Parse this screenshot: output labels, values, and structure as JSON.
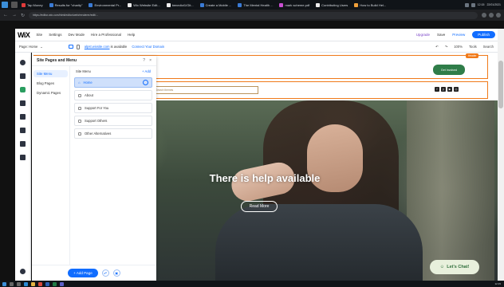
{
  "browser": {
    "tabs": [
      {
        "label": "Tap Money",
        "color": "#e03b3b"
      },
      {
        "label": "Results for \"charity\"",
        "color": "#3a7bd5"
      },
      {
        "label": "Environmental Pr...",
        "color": "#3a7bd5"
      },
      {
        "label": "Wix Website Edit...",
        "color": "#eeeeee"
      },
      {
        "label": "benedict1/Git...",
        "color": "#eeeeee"
      },
      {
        "label": "Create a Mobile ...",
        "color": "#3a7bd5"
      },
      {
        "label": "The Mental Health ...",
        "color": "#3a7bd5"
      },
      {
        "label": "mark scheme.pdf",
        "color": "#c94fd1"
      },
      {
        "label": "Contributing Users",
        "color": "#eeeeee"
      },
      {
        "label": "How to Build Hel...",
        "color": "#f0a03a"
      }
    ],
    "url": "https://editor.wix.com/html/editor/web/renderer/edit/...",
    "clock_time": "12:15",
    "clock_date": "22/01/2021"
  },
  "wix": {
    "logo": "WiX",
    "menu": [
      "Site",
      "Settings",
      "Dev Mode",
      "Hire a Professional",
      "Help"
    ],
    "right": {
      "upgrade": "Upgrade",
      "save": "Save",
      "preview": "Preview",
      "publish": "Publish"
    },
    "subbar": {
      "page_label": "Page: Home",
      "domain_link": "alpst.wixsite.com",
      "domain_status": "is available",
      "connect": "Connect Your Domain",
      "zoom": "100%",
      "tools": "Tools",
      "search": "Search"
    }
  },
  "panel": {
    "title": "Site Pages and Menu",
    "help": "?",
    "close": "×",
    "nav": [
      "Site Menu",
      "Blog Pages",
      "Dynamic Pages"
    ],
    "list_title": "Site Menu",
    "add_label": "+ Add",
    "pages": [
      "Home",
      "About",
      "Support For You",
      "Support Others",
      "Other Alternatives"
    ],
    "add_page_button": "+ Add Page"
  },
  "canvas": {
    "header_tag": "Header",
    "get_involved": "Get Involved",
    "search_placeholder": "Search themes",
    "socials": [
      "f",
      "y",
      "▶",
      "◎"
    ],
    "hero_title": "There is help available",
    "read_more": "Read More",
    "lets_chat": "Let's Chat!"
  },
  "colors": {
    "wix_blue": "#116dff",
    "selection_orange": "#f07a1a",
    "cta_green": "#2f7d49"
  }
}
